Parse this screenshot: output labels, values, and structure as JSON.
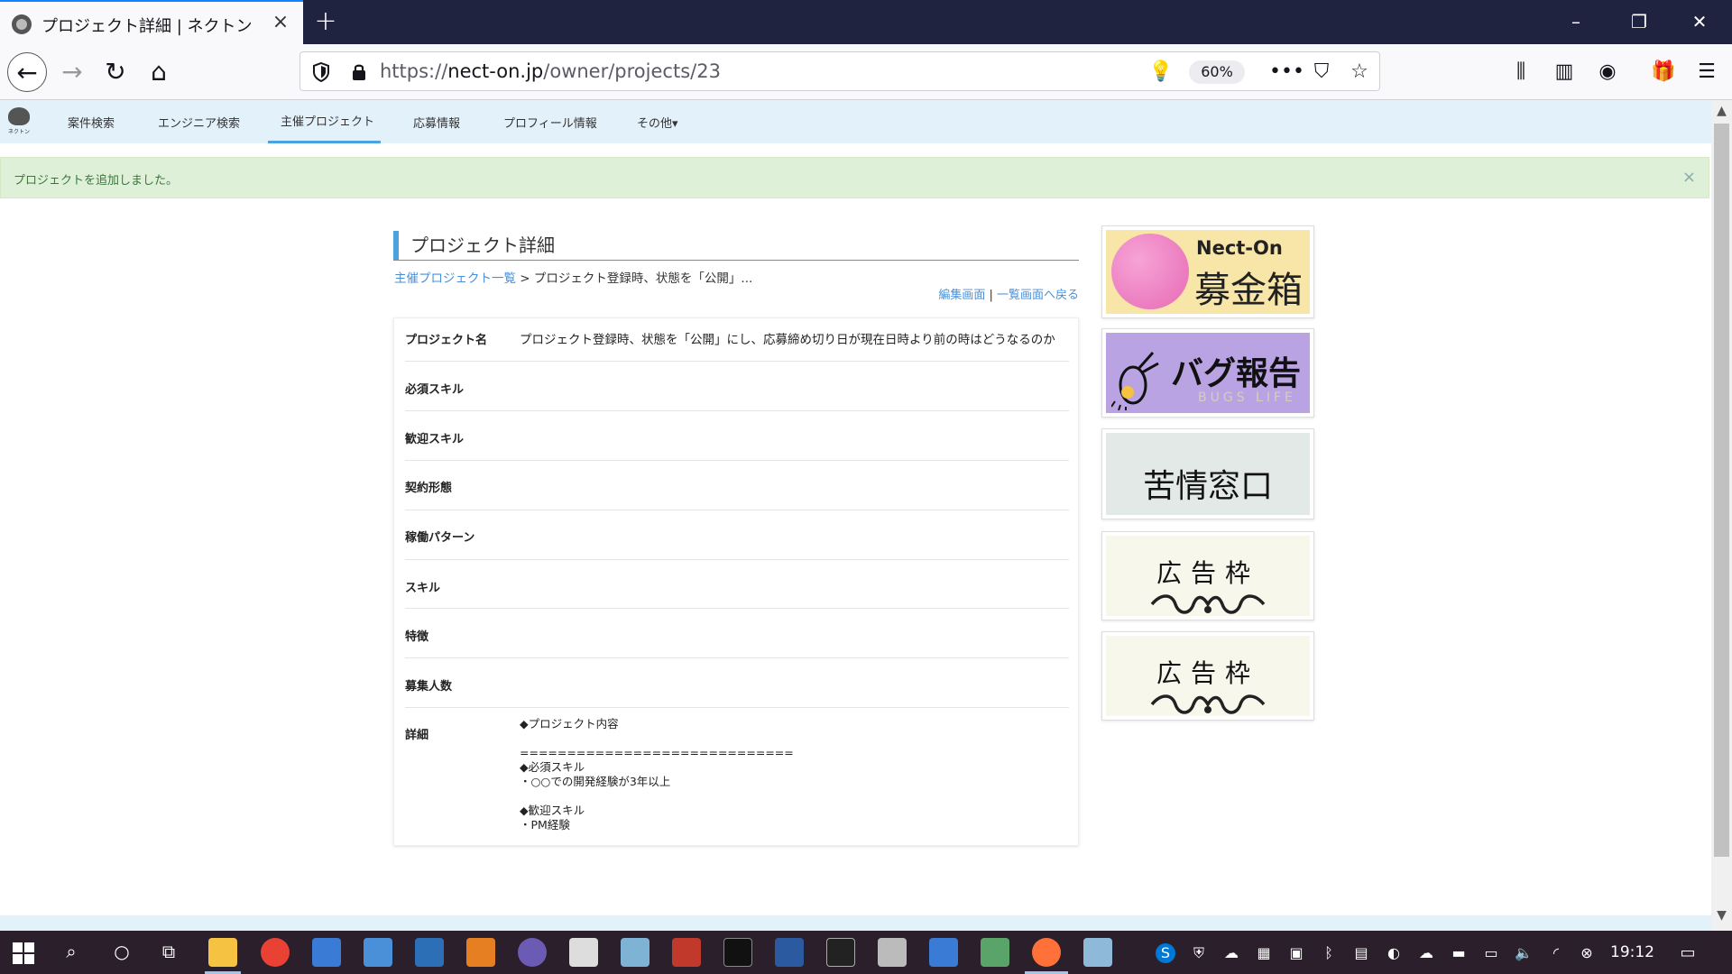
{
  "browser": {
    "tab_title": "プロジェクト詳細 | ネクトン",
    "new_tab_icon": "plus-icon",
    "url_scheme": "https://",
    "url_host": "nect-on.jp",
    "url_path": "/owner/projects/23",
    "zoom": "60%"
  },
  "site_nav": {
    "logo_text": "ネクトン",
    "items": [
      {
        "label": "案件検索"
      },
      {
        "label": "エンジニア検索"
      },
      {
        "label": "主催プロジェクト",
        "active": true
      },
      {
        "label": "応募情報"
      },
      {
        "label": "プロフィール情報"
      },
      {
        "label": "その他▾"
      }
    ]
  },
  "alert": {
    "message": "プロジェクトを追加しました。",
    "close": "×"
  },
  "page": {
    "title": "プロジェクト詳細",
    "breadcrumb_link": "主催プロジェクト一覧",
    "breadcrumb_sep": " > ",
    "breadcrumb_current": "プロジェクト登録時、状態を「公開」...",
    "edit_link": "編集画面",
    "pipe": " | ",
    "back_link": "一覧画面へ戻る"
  },
  "details": {
    "rows": [
      {
        "label": "プロジェクト名",
        "value": "プロジェクト登録時、状態を「公開」にし、応募締め切り日が現在日時より前の時はどうなるのか"
      },
      {
        "label": "必須スキル",
        "value": ""
      },
      {
        "label": "歓迎スキル",
        "value": ""
      },
      {
        "label": "契約形態",
        "value": ""
      },
      {
        "label": "稼働パターン",
        "value": ""
      },
      {
        "label": "スキル",
        "value": ""
      },
      {
        "label": "特徴",
        "value": ""
      },
      {
        "label": "募集人数",
        "value": ""
      },
      {
        "label": "詳細",
        "value": ""
      }
    ],
    "body": "◆プロジェクト内容\n\n=============================\n◆必須スキル\n・○○での開発経験が3年以上\n\n◆歓迎スキル\n・PM経験"
  },
  "banners": {
    "donation_brand": "Nect-On",
    "donation_label": "募金箱",
    "bug_label": "バグ報告",
    "bug_sub": "BUGS LIFE",
    "complaint_label": "苦情窓口",
    "ad1_label": "広告枠",
    "ad2_label": "広告枠"
  },
  "taskbar": {
    "time": "19:12"
  },
  "colors": {
    "tabbar": "#1f2340",
    "site_nav": "#e3f1fb",
    "accent": "#4aa3df",
    "alert_bg": "#dff0d8",
    "alert_text": "#3c763d",
    "link": "#4a90d9",
    "taskbar": "#2b1f2b"
  }
}
